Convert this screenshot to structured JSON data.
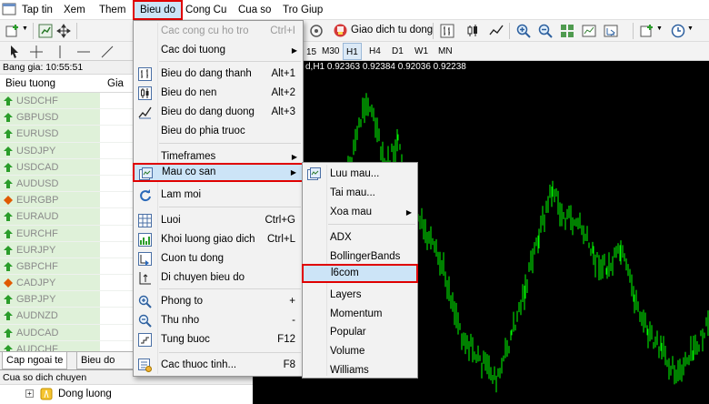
{
  "menubar": {
    "items": [
      {
        "label": "Tap tin"
      },
      {
        "label": "Xem"
      },
      {
        "label": "Them"
      },
      {
        "label": "Bieu do",
        "active": true
      },
      {
        "label": "Cong Cu"
      },
      {
        "label": "Cua so"
      },
      {
        "label": "Tro Giup"
      }
    ]
  },
  "toolbar": {
    "autotrade_label": "Giao dich tu dong"
  },
  "timeframes": {
    "partial_label": "15",
    "items": [
      "M30",
      "H1",
      "H4",
      "D1",
      "W1",
      "MN"
    ],
    "selected": "H1"
  },
  "chart": {
    "info": "d,H1  0.92363 0.92384 0.92036 0.92238",
    "line_color": "#00ff00",
    "background": "#000000"
  },
  "market_watch": {
    "time_label": "Bang gia: 10:55:51",
    "col_symbol": "Bieu tuong",
    "col_bid": "Gia m",
    "symbols": [
      {
        "name": "USDCHF",
        "dir": "up"
      },
      {
        "name": "GBPUSD",
        "dir": "up"
      },
      {
        "name": "EURUSD",
        "dir": "up"
      },
      {
        "name": "USDJPY",
        "dir": "up"
      },
      {
        "name": "USDCAD",
        "dir": "up"
      },
      {
        "name": "AUDUSD",
        "dir": "up"
      },
      {
        "name": "EURGBP",
        "dir": "diamond"
      },
      {
        "name": "EURAUD",
        "dir": "up"
      },
      {
        "name": "EURCHF",
        "dir": "up"
      },
      {
        "name": "EURJPY",
        "dir": "up"
      },
      {
        "name": "GBPCHF",
        "dir": "up"
      },
      {
        "name": "CADJPY",
        "dir": "diamond"
      },
      {
        "name": "GBPJPY",
        "dir": "up"
      },
      {
        "name": "AUDNZD",
        "dir": "up"
      },
      {
        "name": "AUDCAD",
        "dir": "up"
      },
      {
        "name": "AUDCHF",
        "dir": "up"
      }
    ],
    "tabs": [
      "Cap ngoai te",
      "Bieu do tick"
    ]
  },
  "navigator": {
    "title": "Cua so dich chuyen",
    "item": "Dong luong"
  },
  "chart_menu": {
    "items": [
      {
        "label": "Cac cong cu ho tro",
        "shortcut": "Ctrl+I",
        "disabled": true
      },
      {
        "label": "Cac doi tuong",
        "submenu": true
      },
      {
        "label": "Bieu do dang thanh",
        "shortcut": "Alt+1",
        "icon": "bar-chart-icon"
      },
      {
        "label": "Bieu do nen",
        "shortcut": "Alt+2",
        "icon": "candlestick-icon"
      },
      {
        "label": "Bieu do dang duong",
        "shortcut": "Alt+3",
        "icon": "line-chart-icon"
      },
      {
        "label": "Bieu do phia truoc"
      },
      {
        "label": "Timeframes",
        "submenu": true
      },
      {
        "label": "Mau co san",
        "submenu": true,
        "highlighted": true,
        "icon": "template-icon"
      },
      {
        "label": "Lam moi",
        "icon": "refresh-icon"
      },
      {
        "label": "Luoi",
        "shortcut": "Ctrl+G",
        "icon": "grid-icon"
      },
      {
        "label": "Khoi luong giao dich",
        "shortcut": "Ctrl+L",
        "icon": "volume-icon"
      },
      {
        "label": "Cuon tu dong",
        "icon": "autoscroll-icon"
      },
      {
        "label": "Di chuyen bieu do",
        "icon": "chart-shift-icon"
      },
      {
        "label": "Phong to",
        "shortcut": "+",
        "icon": "zoom-in-icon"
      },
      {
        "label": "Thu nho",
        "shortcut": "-",
        "icon": "zoom-out-icon"
      },
      {
        "label": "Tung buoc",
        "shortcut": "F12",
        "icon": "step-icon"
      },
      {
        "label": "Cac thuoc tinh...",
        "shortcut": "F8",
        "icon": "properties-icon"
      }
    ]
  },
  "template_menu": {
    "items": [
      {
        "label": "Luu mau...",
        "icon": "save-template-icon"
      },
      {
        "label": "Tai mau..."
      },
      {
        "label": "Xoa mau",
        "submenu": true
      },
      {
        "label": "ADX"
      },
      {
        "label": "BollingerBands"
      },
      {
        "label": "l6com",
        "highlighted": true
      },
      {
        "label": "Layers"
      },
      {
        "label": "Momentum"
      },
      {
        "label": "Popular"
      },
      {
        "label": "Volume"
      },
      {
        "label": "Williams"
      }
    ]
  },
  "colors": {
    "accent_highlight": "#cce4f7",
    "annotation_red": "#e00000",
    "up_arrow": "#2a9d2a",
    "down_diamond": "#e05a00"
  }
}
